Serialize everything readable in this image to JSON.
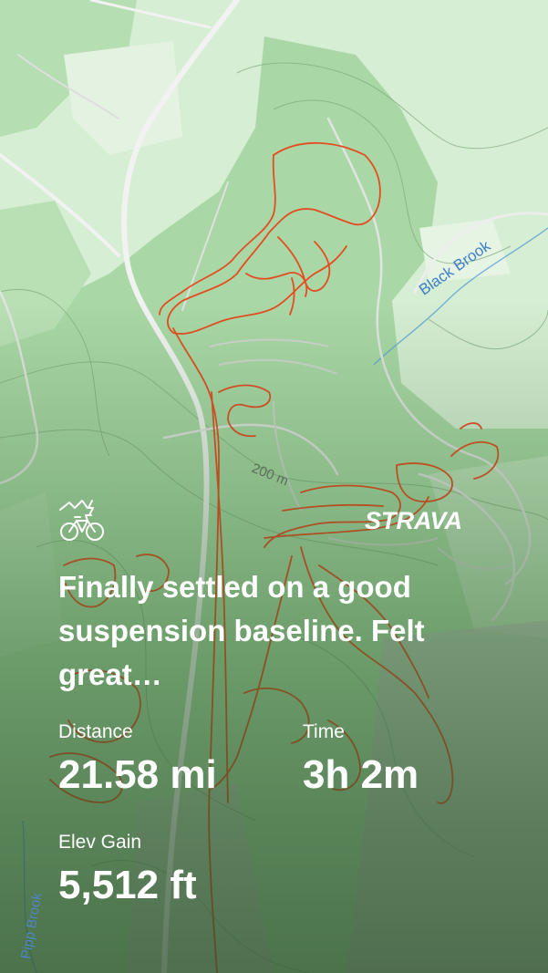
{
  "activity": {
    "type_icon": "e-bike-icon",
    "title": "Finally settled on a good suspension baseline. Felt great…"
  },
  "brand": {
    "logo_text": "STRAVA"
  },
  "stats": {
    "distance": {
      "label": "Distance",
      "value": "21.58 mi"
    },
    "time": {
      "label": "Time",
      "value": "3h 2m"
    },
    "elev_gain": {
      "label": "Elev Gain",
      "value": "5,512 ft"
    }
  },
  "map": {
    "labels": {
      "stream_1": "Black Brook",
      "contour": "200 m",
      "stream_2": "Pipp Brook"
    },
    "colors": {
      "route": "#e8451b",
      "forest": "#a8d9a6",
      "open": "#d9efd6",
      "water": "#5b9fd8",
      "road": "#e9e9e9"
    }
  }
}
